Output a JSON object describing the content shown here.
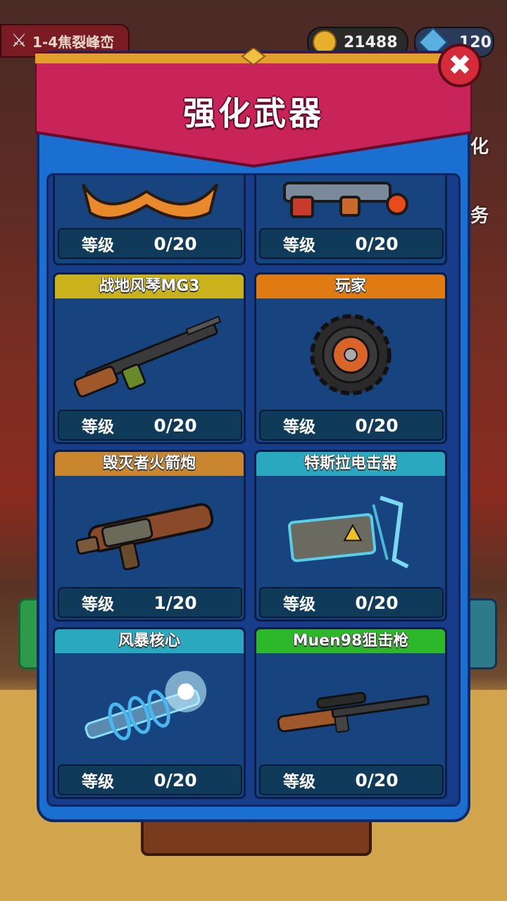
{
  "hud": {
    "stage": "1-4焦裂峰峦",
    "coins": "21488",
    "gems": "120"
  },
  "side": {
    "label_1": "化",
    "label_2": "务"
  },
  "modal": {
    "title": "强化武器"
  },
  "level_label": "等级",
  "top_row": [
    {
      "level": "0/20"
    },
    {
      "level": "0/20"
    }
  ],
  "weapons": [
    {
      "name": "战地风琴MG3",
      "level": "0/20",
      "color": "#c9b21c",
      "icon": "machine-gun-icon"
    },
    {
      "name": "玩家",
      "level": "0/20",
      "color": "#e07a12",
      "icon": "saw-blade-icon"
    },
    {
      "name": "毁灭者火箭炮",
      "level": "1/20",
      "color": "#c9862e",
      "icon": "rocket-launcher-icon"
    },
    {
      "name": "特斯拉电击器",
      "level": "0/20",
      "color": "#2aa8c0",
      "icon": "tesla-shocker-icon"
    },
    {
      "name": "风暴核心",
      "level": "0/20",
      "color": "#2aa8c0",
      "icon": "storm-core-icon"
    },
    {
      "name": "Muen98狙击枪",
      "level": "0/20",
      "color": "#2db82a",
      "icon": "sniper-rifle-icon"
    }
  ]
}
